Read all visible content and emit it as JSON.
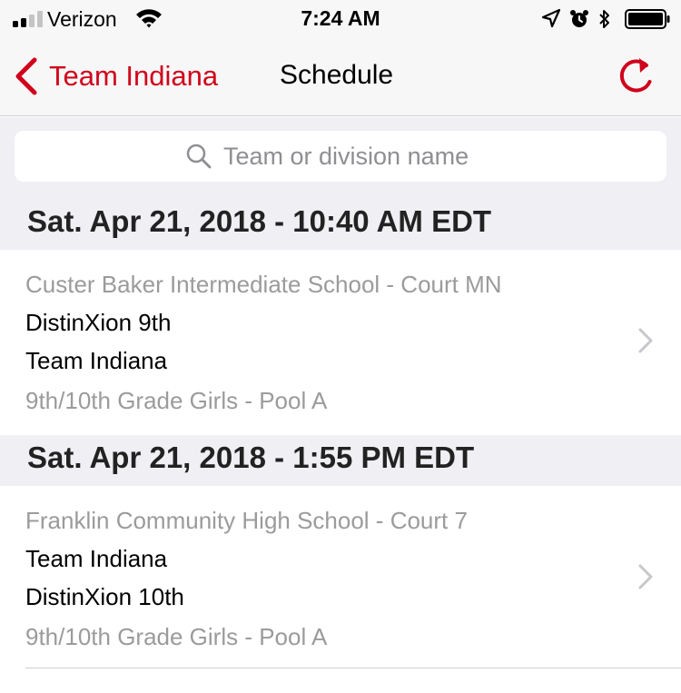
{
  "status_bar": {
    "carrier": "Verizon",
    "time": "7:24 AM",
    "signal_bars_filled": 2,
    "signal_bars_total": 4,
    "icons": [
      "signal-icon",
      "wifi-icon",
      "location-arrow-icon",
      "alarm-icon",
      "bluetooth-icon",
      "battery-icon"
    ]
  },
  "nav": {
    "back_label": "Team Indiana",
    "title": "Schedule",
    "back_icon": "chevron-left-icon",
    "refresh_icon": "refresh-icon"
  },
  "search": {
    "placeholder": "Team or division name",
    "value": "",
    "icon": "search-icon"
  },
  "schedule": [
    {
      "header": "Sat. Apr 21, 2018 - 10:40 AM EDT",
      "venue": "Custer Baker Intermediate School - Court MN",
      "team1": "DistinXion 9th",
      "team2": "Team Indiana",
      "division": "9th/10th Grade Girls - Pool A"
    },
    {
      "header": "Sat. Apr 21, 2018 - 1:55 PM EDT",
      "venue": "Franklin Community High School - Court 7",
      "team1": "Team Indiana",
      "team2": "DistinXion 10th",
      "division": "9th/10th Grade Girls - Pool A"
    }
  ],
  "colors": {
    "accent": "#d0021b",
    "bar_background": "#f7f7f7",
    "group_background": "#efeff4",
    "secondary_text": "#9b9b9b",
    "chevron": "#c7c7cc"
  }
}
